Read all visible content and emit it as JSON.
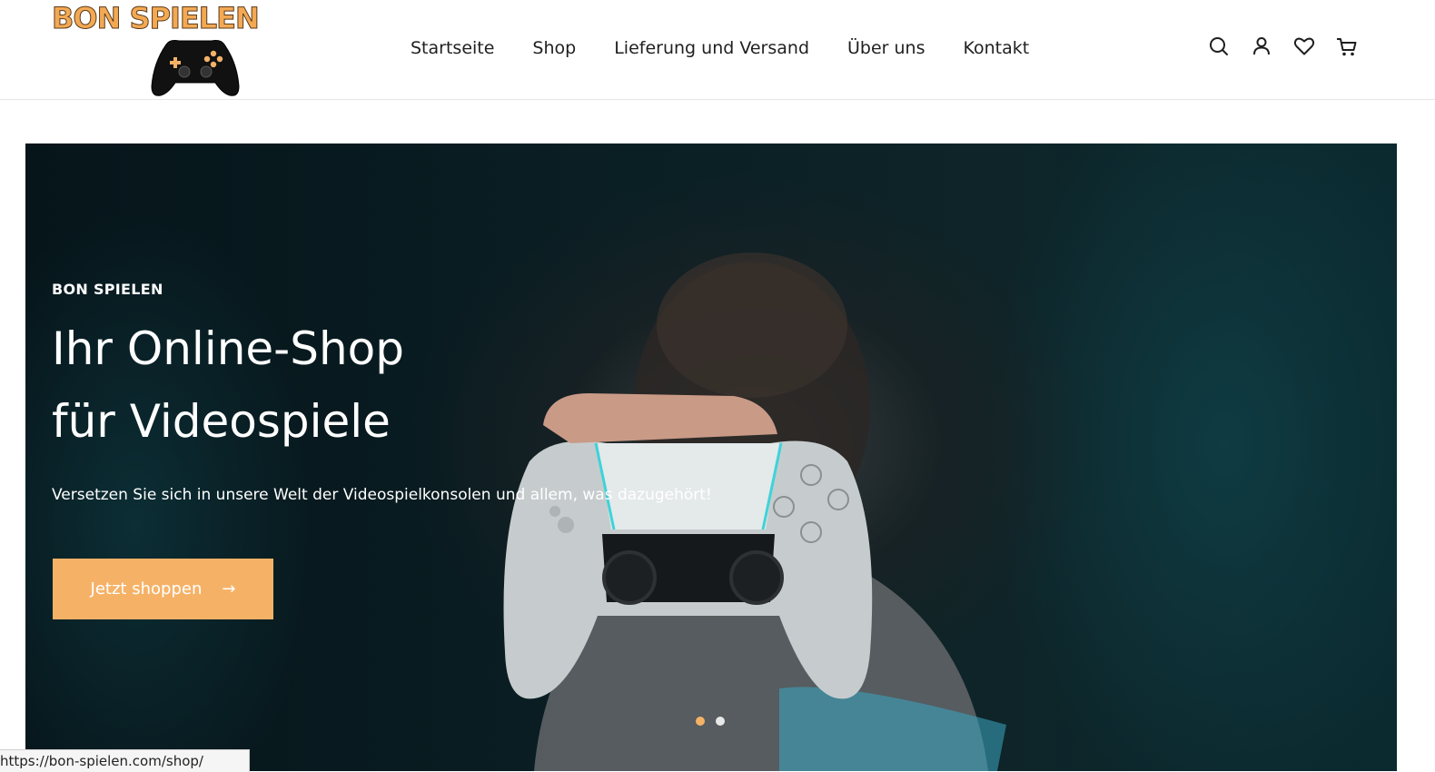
{
  "brand": {
    "logo_text": "BON SPIELEN",
    "accent_color": "#f5b267"
  },
  "nav": {
    "items": [
      {
        "label": "Startseite"
      },
      {
        "label": "Shop"
      },
      {
        "label": "Lieferung und Versand"
      },
      {
        "label": "Über uns"
      },
      {
        "label": "Kontakt"
      }
    ]
  },
  "header_icons": [
    "search-icon",
    "account-icon",
    "wishlist-heart-icon",
    "cart-icon"
  ],
  "hero": {
    "kicker": "BON SPIELEN",
    "title_line1": "Ihr Online-Shop",
    "title_line2": "für Videospiele",
    "subtitle": "Versetzen Sie sich in unsere Welt der Videospielkonsolen und allem, was dazugehört!",
    "cta_label": "Jetzt shoppen",
    "cta_arrow": "→",
    "slides_total": 2,
    "active_slide": 1
  },
  "status_bar": {
    "url": "https://bon-spielen.com/shop/"
  }
}
